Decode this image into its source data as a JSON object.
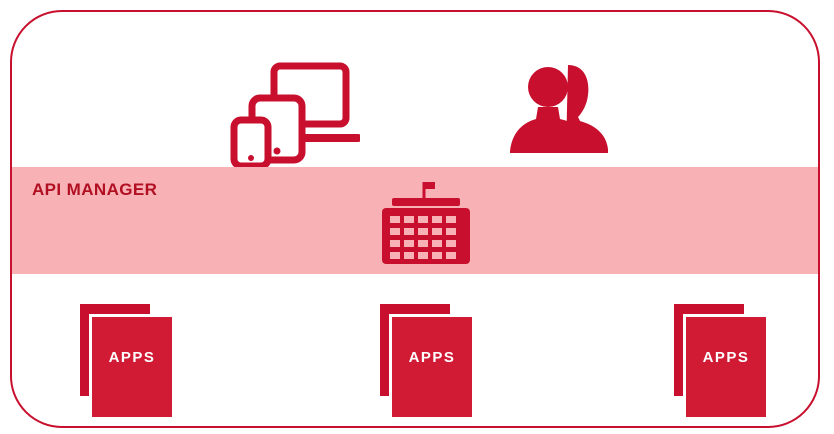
{
  "colors": {
    "accent": "#c8102e",
    "band": "#f8b2b5",
    "band_label": "#b10f22"
  },
  "api_manager": {
    "label": "API  MANAGER",
    "icon": "gateway-building-icon"
  },
  "top_icons": [
    {
      "name": "devices-icon"
    },
    {
      "name": "users-icon"
    }
  ],
  "apps": [
    {
      "label": "APPS",
      "icon": "apps-document-icon"
    },
    {
      "label": "APPS",
      "icon": "apps-document-icon"
    },
    {
      "label": "APPS",
      "icon": "apps-document-icon"
    }
  ]
}
